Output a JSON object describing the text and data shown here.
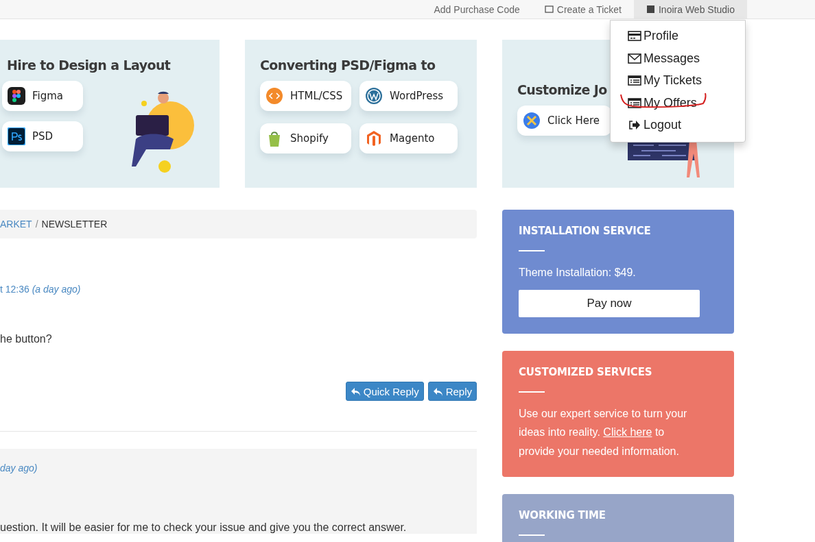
{
  "header": {
    "nav": [
      {
        "label": "Add Purchase Code",
        "selected": false
      },
      {
        "label": "Create a Ticket",
        "selected": false
      },
      {
        "label": "Inoira Web Studio",
        "selected": true
      }
    ]
  },
  "user_menu": {
    "items": [
      {
        "label": "Profile",
        "highlighted": false
      },
      {
        "label": "Messages",
        "highlighted": false
      },
      {
        "label": "My Tickets",
        "highlighted": false
      },
      {
        "label": "My Offers",
        "highlighted": true
      },
      {
        "label": "Logout",
        "highlighted": false
      }
    ]
  },
  "banners": [
    {
      "title": "Hire to Design a Layout",
      "chips": [
        "Figma",
        "PSD"
      ]
    },
    {
      "title": "Converting PSD/Figma to",
      "chips": [
        "HTML/CSS",
        "WordPress",
        "Shopify",
        "Magento"
      ]
    },
    {
      "title": "Customize Jo",
      "chips": [
        "Click Here"
      ]
    }
  ],
  "breadcrumb": {
    "link": "ARKET",
    "separator": "/",
    "current": "NEWSLETTER"
  },
  "posts": [
    {
      "time": "t 12:36",
      "ago": "(a day ago)",
      "text": "he button?",
      "buttons": [
        "Quick Reply",
        "Reply"
      ],
      "shaded": false
    },
    {
      "ago": "day ago)",
      "text": "uestion. It will be easier for me to check your issue and give you the correct answer.",
      "shaded": true
    }
  ],
  "sidebar": [
    {
      "title": "INSTALLATION SERVICE",
      "color": "#6f8bd0",
      "text": "Theme Installation: $49.",
      "button": "Pay now"
    },
    {
      "title": "CUSTOMIZED SERVICES",
      "color": "#ec7668",
      "text_before": "Use our expert service to turn your ideas into reality.",
      "link": "Click here",
      "text_after": "to provide your needed information."
    },
    {
      "title": "WORKING TIME",
      "color": "#97a5c8"
    }
  ]
}
